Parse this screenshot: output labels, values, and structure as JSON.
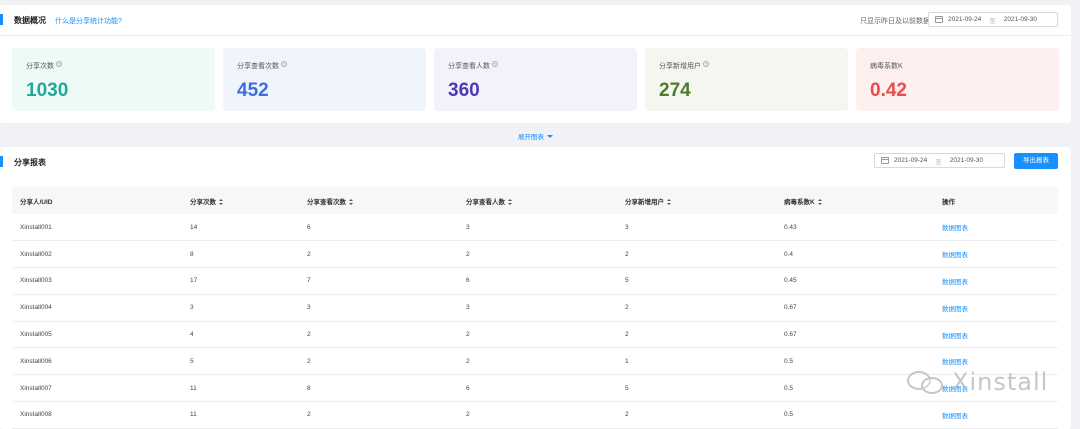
{
  "overview": {
    "title": "数据概况",
    "help_link": "什么是分享统计功能?",
    "note": "只显示昨日及以前数据",
    "date_start": "2021-09-24",
    "date_end": "2021-09-30",
    "date_sep": "至",
    "cards": [
      {
        "label": "分享次数",
        "value": "1030",
        "color": "#26a69a",
        "bg": "#eefaf8"
      },
      {
        "label": "分享查看次数",
        "value": "452",
        "color": "#3b6fe0",
        "bg": "#eff4fd"
      },
      {
        "label": "分享查看人数",
        "value": "360",
        "color": "#4a3ab5",
        "bg": "#f3f2fc"
      },
      {
        "label": "分享新增用户",
        "value": "274",
        "color": "#4d7a2b",
        "bg": "#f5f6ef"
      },
      {
        "label": "病毒系数K",
        "value": "0.42",
        "color": "#e94c4c",
        "bg": "#fdf0ee"
      }
    ],
    "help_glyph": "?"
  },
  "expand_label": "展开图表",
  "report": {
    "title": "分享报表",
    "date_start": "2021-09-24",
    "date_end": "2021-09-30",
    "date_sep": "至",
    "export_label": "导出报表",
    "columns": [
      "分享人/UID",
      "分享次数",
      "分享查看次数",
      "分享查看人数",
      "分享新增用户",
      "病毒系数K",
      "操作"
    ],
    "rows": [
      [
        "Xinstall001",
        "14",
        "6",
        "3",
        "3",
        "0.43",
        "数据图表"
      ],
      [
        "Xinstall002",
        "8",
        "2",
        "2",
        "2",
        "0.4",
        "数据图表"
      ],
      [
        "Xinstall003",
        "17",
        "7",
        "6",
        "5",
        "0.45",
        "数据图表"
      ],
      [
        "Xinstall004",
        "3",
        "3",
        "3",
        "2",
        "0.67",
        "数据图表"
      ],
      [
        "Xinstall005",
        "4",
        "2",
        "2",
        "2",
        "0.67",
        "数据图表"
      ],
      [
        "Xinstall006",
        "5",
        "2",
        "2",
        "1",
        "0.5",
        "数据图表"
      ],
      [
        "Xinstall007",
        "11",
        "8",
        "6",
        "5",
        "0.5",
        "数据图表"
      ],
      [
        "Xinstall008",
        "11",
        "2",
        "2",
        "2",
        "0.5",
        "数据图表"
      ]
    ]
  },
  "watermark": "Xinstall",
  "accent_color": "#1890ff"
}
